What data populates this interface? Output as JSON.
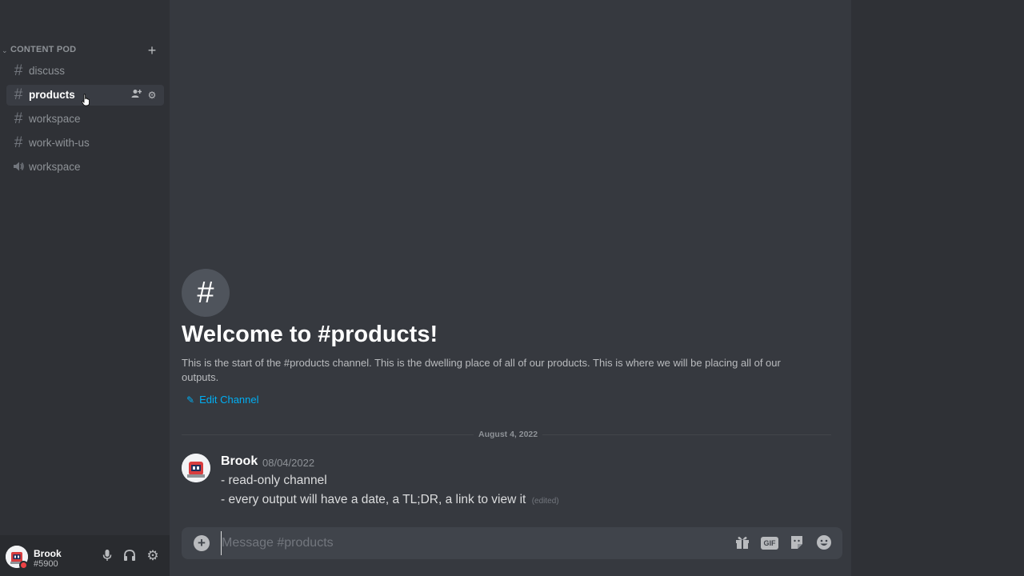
{
  "sidebar": {
    "category": {
      "title": "CONTENT POD",
      "chevron": "chevron-down-icon",
      "add_icon": "plus-icon"
    },
    "channels": [
      {
        "label": "discuss",
        "type": "text",
        "icon": "hashtag-icon",
        "active": false
      },
      {
        "label": "products",
        "type": "text",
        "icon": "hashtag-icon",
        "active": true,
        "actions": [
          "invite-icon",
          "gear-icon"
        ]
      },
      {
        "label": "workspace",
        "type": "text",
        "icon": "hashtag-icon",
        "active": false
      },
      {
        "label": "work-with-us",
        "type": "text",
        "icon": "hashtag-icon",
        "active": false
      },
      {
        "label": "workspace",
        "type": "voice",
        "icon": "speaker-icon",
        "active": false
      }
    ]
  },
  "user_panel": {
    "name": "Brook",
    "tag": "#5900",
    "status_color": "#ed4245",
    "buttons": [
      "microphone-icon",
      "headphones-icon",
      "gear-icon"
    ]
  },
  "welcome": {
    "icon": "hashtag-icon",
    "title": "Welcome to #products!",
    "description": "This is the start of the #products channel. This is the dwelling place of all of our products. This is where we will be placing all of our outputs.",
    "edit_label": "Edit Channel"
  },
  "divider": {
    "date": "August 4, 2022"
  },
  "message": {
    "author": "Brook",
    "timestamp": "08/04/2022",
    "lines": [
      "- read-only channel",
      "- every output will have a date, a TL;DR, a link to view it"
    ],
    "edited_label": "(edited)"
  },
  "composer": {
    "placeholder": "Message #products",
    "gif_label": "GIF",
    "buttons": [
      "gift-icon",
      "gif-icon",
      "sticker-icon",
      "emoji-icon"
    ]
  },
  "colors": {
    "sidebar_bg": "#2f3136",
    "main_bg": "#36393f",
    "link": "#00aff4",
    "active_channel_bg": "#393c43"
  }
}
